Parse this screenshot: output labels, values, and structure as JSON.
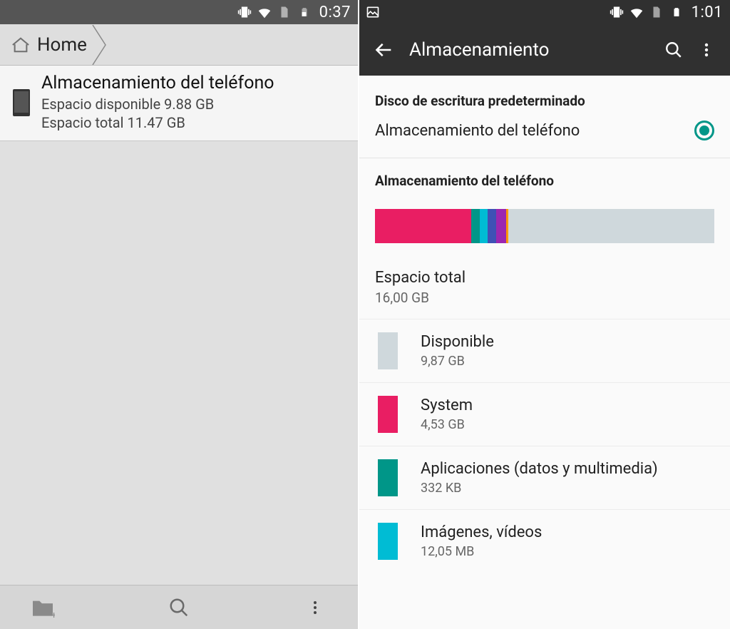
{
  "left": {
    "statusbar": {
      "time": "0:37"
    },
    "breadcrumb": {
      "home": "Home"
    },
    "item": {
      "title": "Almacenamiento del teléfono",
      "line1": "Espacio disponible 9.88 GB",
      "line2": "Espacio total 11.47 GB"
    }
  },
  "right": {
    "statusbar": {
      "time": "1:01"
    },
    "appbar": {
      "title": "Almacenamiento"
    },
    "default_disk_title": "Disco de escritura predeterminado",
    "default_disk_option": "Almacenamiento del teléfono",
    "storage_section_title": "Almacenamiento del teléfono",
    "total": {
      "label": "Espacio total",
      "value": "16,00 GB"
    },
    "categories": [
      {
        "label": "Disponible",
        "value": "9,87 GB",
        "swatch": "sw-avail"
      },
      {
        "label": "System",
        "value": "4,53 GB",
        "swatch": "sw-system"
      },
      {
        "label": "Aplicaciones (datos y multimedia)",
        "value": "332 KB",
        "swatch": "sw-apps"
      },
      {
        "label": "Imágenes, vídeos",
        "value": "12,05 MB",
        "swatch": "sw-img"
      }
    ],
    "chart": {
      "segments": [
        {
          "class": "seg-system",
          "pct": 28.3
        },
        {
          "class": "seg-apps",
          "pct": 2.5
        },
        {
          "class": "seg-img",
          "pct": 2.5
        },
        {
          "class": "seg-audio",
          "pct": 2.5
        },
        {
          "class": "seg-dl",
          "pct": 2.8
        },
        {
          "class": "seg-cache",
          "pct": 0.6
        }
      ]
    }
  },
  "chart_data": {
    "type": "bar",
    "title": "Almacenamiento del teléfono",
    "categories": [
      "System",
      "Aplicaciones (datos y multimedia)",
      "Imágenes, vídeos",
      "Disponible"
    ],
    "values_gb": [
      4.53,
      0.000332,
      0.01205,
      9.87
    ],
    "total_gb": 16.0
  }
}
